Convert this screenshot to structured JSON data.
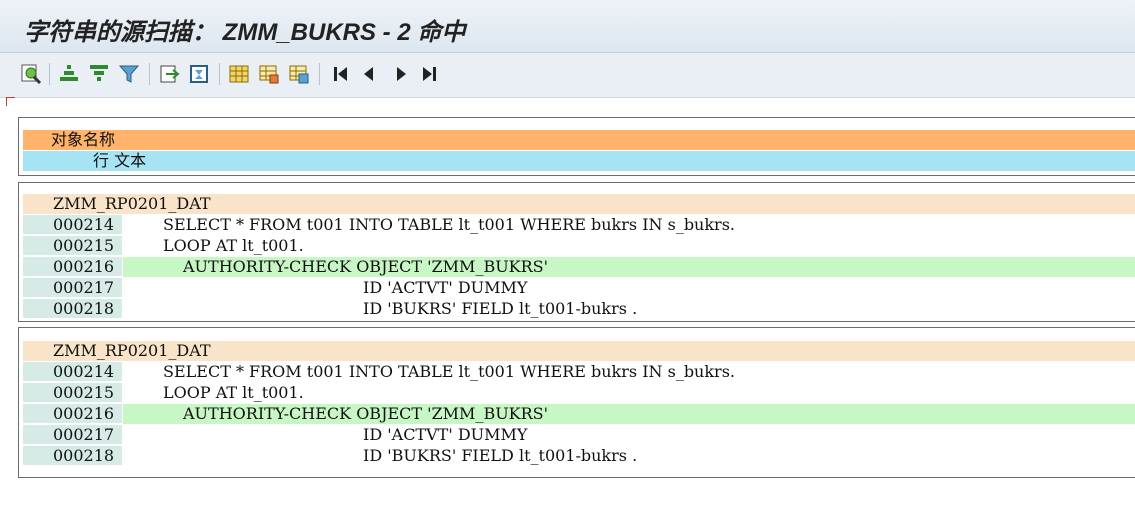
{
  "window": {
    "title": "字符串的源扫描： ZMM_BUKRS - 2 命中"
  },
  "toolbar": {
    "buttons": [
      {
        "name": "find-icon"
      },
      {
        "name": "sort-ascending-icon"
      },
      {
        "name": "sort-descending-icon"
      },
      {
        "name": "filter-icon"
      },
      {
        "name": "export-icon"
      },
      {
        "name": "print-icon"
      },
      {
        "name": "layout-grid-icon"
      },
      {
        "name": "layout-select-icon"
      },
      {
        "name": "layout-save-icon"
      },
      {
        "name": "first-page-icon"
      },
      {
        "name": "previous-page-icon"
      },
      {
        "name": "next-page-icon"
      },
      {
        "name": "last-page-icon"
      }
    ]
  },
  "header": {
    "col1": "对象名称",
    "col2": "行 文本"
  },
  "results": [
    {
      "program": "ZMM_RP0201_DAT",
      "lines": [
        {
          "no": "000214",
          "text": "SELECT * FROM t001 INTO TABLE lt_t001 WHERE bukrs IN s_bukrs.",
          "hit": false
        },
        {
          "no": "000215",
          "text": "LOOP AT lt_t001.",
          "hit": false
        },
        {
          "no": "000216",
          "text": "AUTHORITY-CHECK OBJECT 'ZMM_BUKRS'",
          "hit": true
        },
        {
          "no": "000217",
          "text": "ID 'ACTVT' DUMMY",
          "hit": false
        },
        {
          "no": "000218",
          "text": "ID 'BUKRS' FIELD lt_t001-bukrs .",
          "hit": false
        }
      ]
    },
    {
      "program": "ZMM_RP0201_DAT",
      "lines": [
        {
          "no": "000214",
          "text": "SELECT * FROM t001 INTO TABLE lt_t001 WHERE bukrs IN s_bukrs.",
          "hit": false
        },
        {
          "no": "000215",
          "text": "LOOP AT lt_t001.",
          "hit": false
        },
        {
          "no": "000216",
          "text": "AUTHORITY-CHECK OBJECT 'ZMM_BUKRS'",
          "hit": true
        },
        {
          "no": "000217",
          "text": "ID 'ACTVT' DUMMY",
          "hit": false
        },
        {
          "no": "000218",
          "text": "ID 'BUKRS' FIELD lt_t001-bukrs .",
          "hit": false
        }
      ]
    }
  ],
  "colors": {
    "header_orange": "#ffb36b",
    "header_cyan": "#a6e3f3",
    "program_row": "#f9e3c9",
    "hit_row": "#c7f7c4",
    "line_no": "#d6eae6"
  }
}
